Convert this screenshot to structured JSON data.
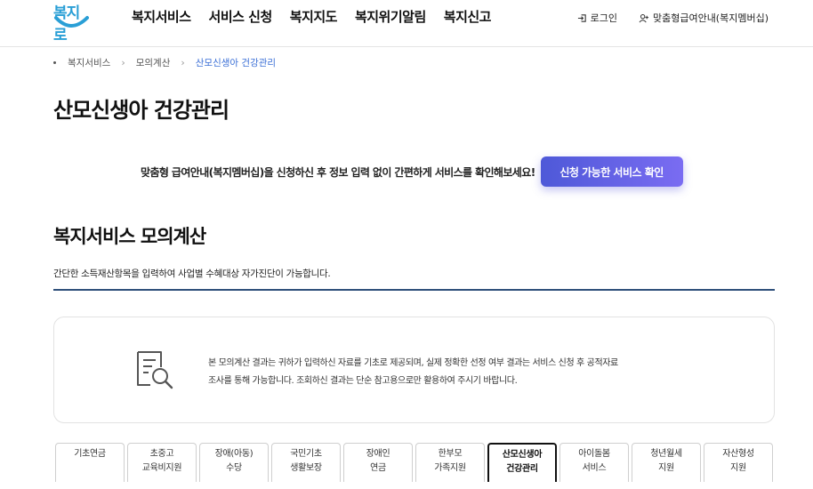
{
  "header": {
    "logo_text": "복지로",
    "nav": [
      "복지서비스",
      "서비스 신청",
      "복지지도",
      "복지위기알림",
      "복지신고"
    ],
    "login_label": "로그인",
    "membership_label": "맞춤형급여안내(복지멤버십)"
  },
  "breadcrumb": [
    "복지서비스",
    "모의계산",
    "산모신생아 건강관리"
  ],
  "page_title": "산모신생아 건강관리",
  "promo": {
    "text": "맞춤형 급여안내(복지멤버십)을 신청하신 후 정보 입력 없이 간편하게 서비스를 확인해보세요!",
    "button_label": "신청 가능한 서비스 확인"
  },
  "section": {
    "title": "복지서비스 모의계산",
    "description": "간단한 소득재산항목을 입력하여 사업별 수혜대상 자가진단이 가능합니다."
  },
  "notice": {
    "line1": "본 모의계산 결과는 귀하가 입력하신 자료를 기초로 제공되며, 실제 정확한 선정 여부 결과는 서비스 신청 후 공적자료",
    "line2": "조사를 통해 가능합니다. 조회하신 결과는 단순 참고용으로만 활용하여 주시기 바랍니다."
  },
  "tabs": [
    {
      "label": "기초연금"
    },
    {
      "label": "초중고\n교육비지원"
    },
    {
      "label": "장애(아동)\n수당"
    },
    {
      "label": "국민기초\n생활보장"
    },
    {
      "label": "장애인\n연금"
    },
    {
      "label": "한부모\n가족지원"
    },
    {
      "label": "산모신생아\n건강관리"
    },
    {
      "label": "아이돌봄\n서비스"
    },
    {
      "label": "청년월세\n지원"
    },
    {
      "label": "자산형성\n지원"
    }
  ],
  "active_tab_index": 6,
  "colors": {
    "accent": "#5b5fe0",
    "breadcrumb_current": "#3b6fd6",
    "section_line": "#2e4f7a"
  }
}
